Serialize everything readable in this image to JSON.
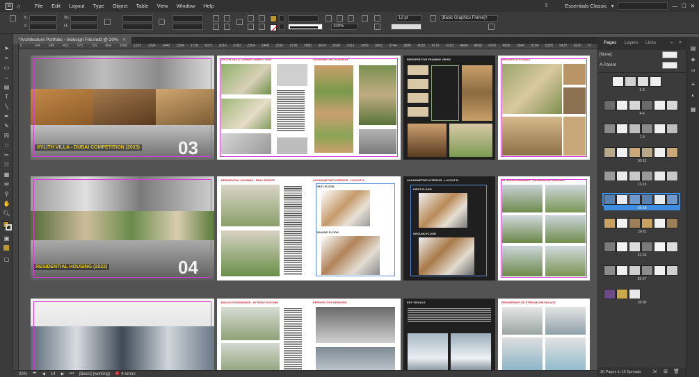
{
  "menubar": {
    "items": [
      "File",
      "Edit",
      "Layout",
      "Type",
      "Object",
      "Table",
      "View",
      "Window",
      "Help"
    ],
    "workspace": "Essentials Classic"
  },
  "control": {
    "x_label": "X:",
    "y_label": "Y:",
    "w_label": "W:",
    "h_label": "H:",
    "stroke_weight": "12 pt",
    "opacity": "100%",
    "object_style": "[Basic Graphics Frame]+",
    "fill_color": "#b8972f",
    "stroke_color": "#ffffff"
  },
  "document": {
    "tab_title": "*Architecture Portfolio - Indesign File.indd @ 20%",
    "close": "✕"
  },
  "ruler": {
    "ticks": [
      "0",
      "144",
      "288",
      "432",
      "576",
      "720",
      "864",
      "1008",
      "1152",
      "1296",
      "1440",
      "1584",
      "1728",
      "1872",
      "2016",
      "2160",
      "2304",
      "2448",
      "2592",
      "2736",
      "2880",
      "3024",
      "3168",
      "3312",
      "3456",
      "3600",
      "3744",
      "3888",
      "4032",
      "4176",
      "4320",
      "4464",
      "4608",
      "4752",
      "4896",
      "5040",
      "5184",
      "5328",
      "5472",
      "5616",
      "57"
    ]
  },
  "spreads": [
    {
      "title": "XYLITH VILLA - DUBAI COMPETITION (2023)",
      "number": "03",
      "p2_title": "XYLITH VILLA - DUBAI COMPETITION",
      "p3_title": "AXONOMETRIC INTERIOR",
      "p4_title": "RENDERS FOR FRAMING VIEWS",
      "p5_title": "RENDERS & SCENES"
    },
    {
      "title": "RESIDENTIAL HOUSING (2022)",
      "number": "04",
      "p2_title": "RESIDENTIAL HOUSING - REAL ESTATE",
      "p3_title": "AXONOMETRIC INTERIOR - LAYOUT A",
      "p3_floor1": "FIRST FLOOR",
      "p3_floor2": "GROUND FLOOR",
      "p4_title": "AXONOMETRIC INTERIOR - LAYOUT B",
      "p4_floor1": "FIRST FLOOR",
      "p4_floor2": "GROUND FLOOR",
      "p5_title": "EXTERIOR RENDERS - RESIDENTIAL HOUSING"
    },
    {
      "p2_title": "BALAJI'S RESIDENCE - INTERACTIVE BIM",
      "p3_title": "PERSPECTIVE RENDERS",
      "p4_title": "KEY VISUALS",
      "p5_title": "RENDERINGS OF STREAMLINE PALACE"
    }
  ],
  "status": {
    "zoom": "20%",
    "page": "14",
    "style": "[Basic] (working)",
    "errors": "4 errors"
  },
  "panel": {
    "tabs": [
      "Pages",
      "Layers",
      "Links"
    ],
    "none_label": "[None]",
    "parent_label": "A-Parent",
    "spread_labels": [
      "1-3",
      "4-6",
      "7-9",
      "10-12",
      "13-15",
      "16-18",
      "19-21",
      "22-24",
      "25-27",
      "28-30"
    ],
    "selected_index": 5,
    "footer": "30 Pages in 10 Spreads"
  }
}
